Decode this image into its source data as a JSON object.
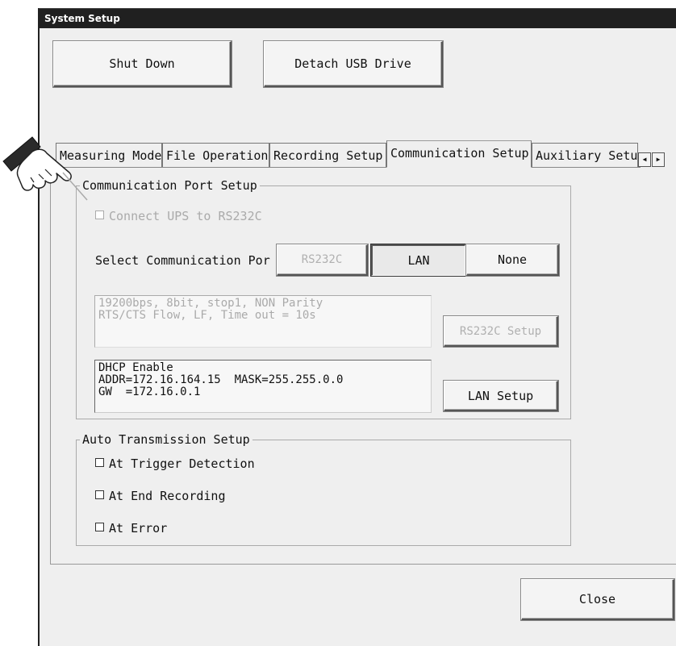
{
  "window": {
    "title": "System Setup"
  },
  "top_buttons": {
    "shutdown": "Shut Down",
    "detach_usb": "Detach USB Drive"
  },
  "tabs": [
    {
      "label": "Measuring Mode",
      "active": false
    },
    {
      "label": "File Operation",
      "active": false
    },
    {
      "label": "Recording Setup",
      "active": false
    },
    {
      "label": "Communication Setup",
      "active": true
    },
    {
      "label": "Auxiliary Setup",
      "active": false
    }
  ],
  "comm_port": {
    "group_title": "Communication Port Setup",
    "ups_checkbox": {
      "label": "Connect UPS to RS232C",
      "checked": false,
      "enabled": false
    },
    "select_label": "Select Communication Por",
    "options": [
      {
        "label": "RS232C",
        "state": "disabled"
      },
      {
        "label": "LAN",
        "state": "selected"
      },
      {
        "label": "None",
        "state": "normal"
      }
    ],
    "rs232c_info": "19200bps, 8bit, stop1, NON Parity\nRTS/CTS Flow, LF, Time out = 10s",
    "rs232c_setup_button": "RS232C Setup",
    "lan_info": "DHCP Enable\nADDR=172.16.164.15  MASK=255.255.0.0\nGW  =172.16.0.1",
    "lan_setup_button": "LAN Setup"
  },
  "auto_transmission": {
    "group_title": "Auto Transmission Setup",
    "items": [
      {
        "label": "At Trigger Detection",
        "checked": false
      },
      {
        "label": "At End Recording",
        "checked": false
      },
      {
        "label": "At Error",
        "checked": false
      }
    ]
  },
  "footer": {
    "close_button": "Close"
  }
}
